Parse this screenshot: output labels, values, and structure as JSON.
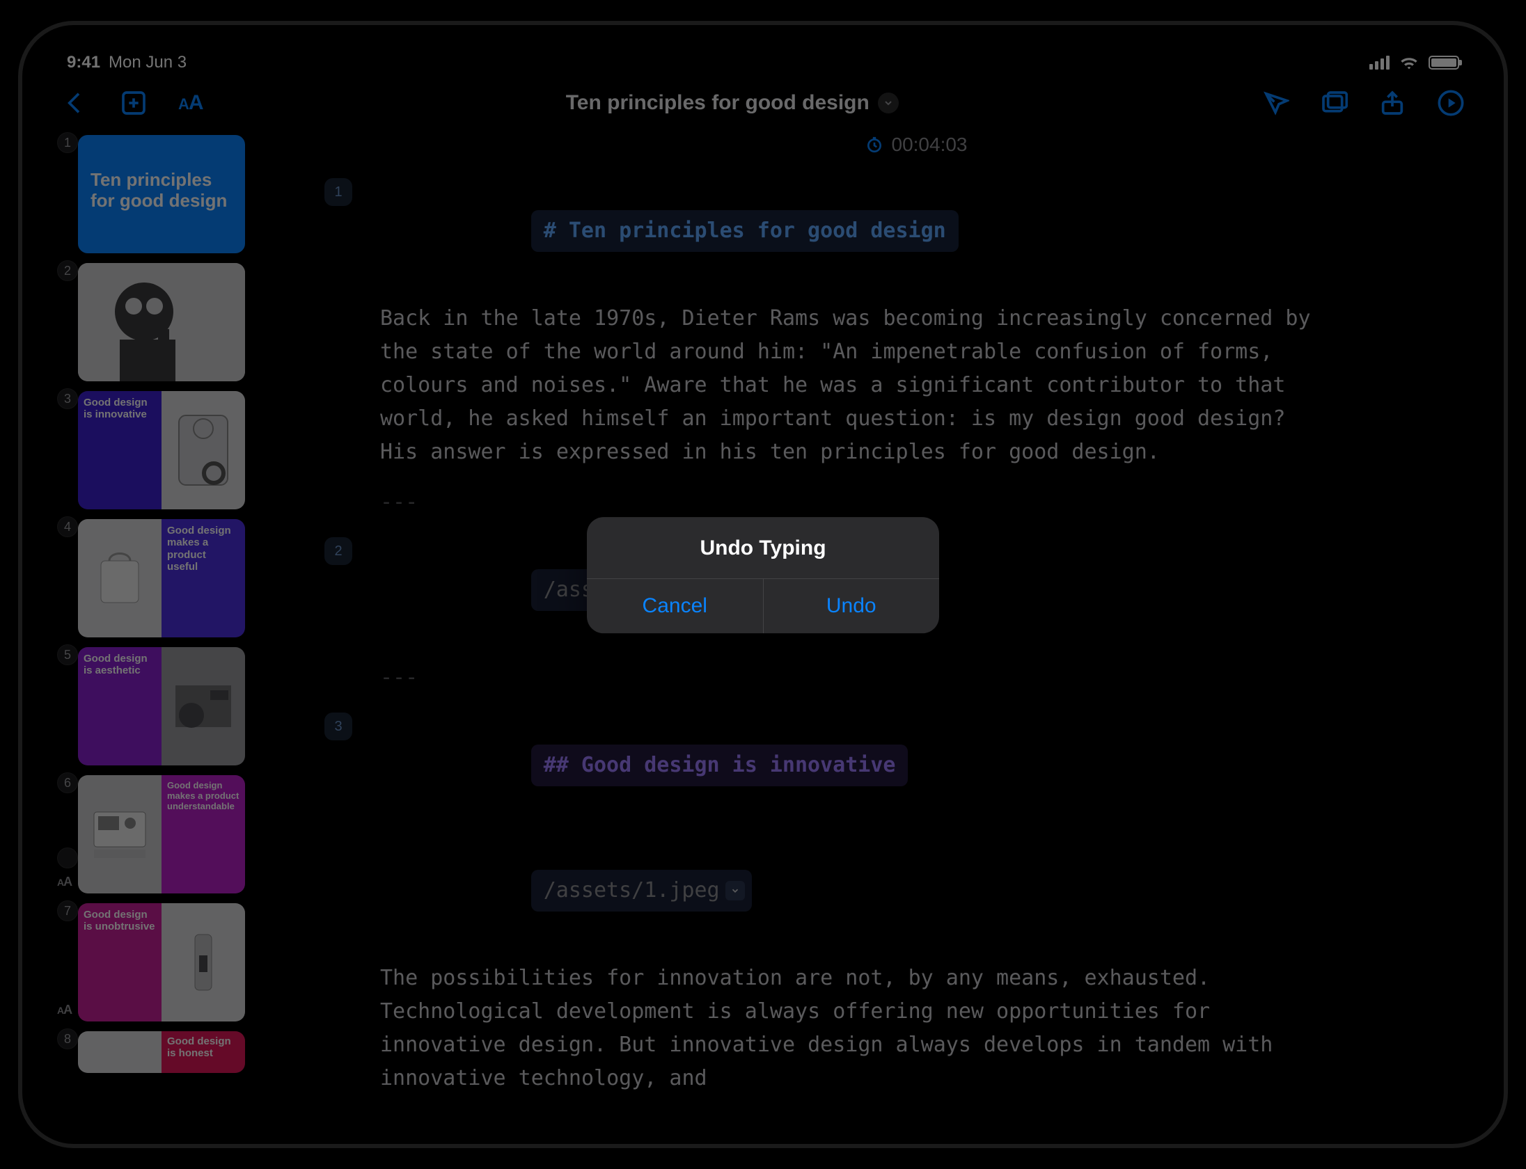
{
  "status": {
    "time": "9:41",
    "date": "Mon Jun 3"
  },
  "toolbar": {
    "title": "Ten principles for good design"
  },
  "timer": "00:04:03",
  "modal": {
    "title": "Undo Typing",
    "cancel": "Cancel",
    "confirm": "Undo"
  },
  "slides": [
    {
      "num": "1",
      "title": "Ten principles for good design"
    },
    {
      "num": "2",
      "title": ""
    },
    {
      "num": "3",
      "title": "Good design is innovative"
    },
    {
      "num": "4",
      "title": "Good design makes a product useful"
    },
    {
      "num": "5",
      "title": "Good design is aesthetic"
    },
    {
      "num": "6",
      "title": "Good design makes a product understandable"
    },
    {
      "num": "7",
      "title": "Good design is unobtrusive"
    },
    {
      "num": "8",
      "title": "Good design is honest"
    }
  ],
  "editor": {
    "b1_num": "1",
    "b1_heading": "# Ten principles for good design",
    "b1_para": "Back in the late 1970s, Dieter Rams was becoming increasingly concerned by the state of the world around him: \"An impenetrable confusion of forms, colours and noises.\" Aware that he was a significant contributor to that world, he asked himself an important question: is my design good design? His answer is expressed in his ten principles for good design.",
    "hr": "---",
    "b2_num": "2",
    "b2_asset": "/assets/0.jpeg",
    "b3_num": "3",
    "b3_heading": "## Good design is innovative",
    "b3_asset": "/assets/1.jpeg",
    "b3_para": "The possibilities for innovation are not, by any means, exhausted. Technological development is always offering new opportunities for innovative design. But innovative design always develops in tandem with innovative technology, and"
  }
}
